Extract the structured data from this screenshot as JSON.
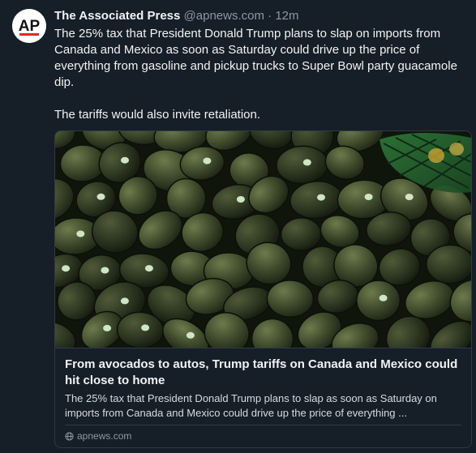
{
  "author": {
    "avatar_text": "AP",
    "display_name": "The Associated Press",
    "handle": "@apnews.com",
    "separator": "·",
    "timestamp": "12m"
  },
  "post": {
    "paragraphs": [
      "The 25% tax that President Donald Trump plans to slap on imports from Canada and Mexico as soon as Saturday could drive up the price of everything from gasoline and pickup trucks to Super Bowl party guacamole dip.",
      "The tariffs would also invite retaliation."
    ]
  },
  "link_card": {
    "title": "From avocados to autos, Trump tariffs on Canada and Mexico could hit close to home",
    "description": "The 25% tax that President Donald Trump plans to slap as soon as Saturday on imports from Canada and Mexico could drive up the price of everything ...",
    "domain": "apnews.com",
    "domain_icon": "globe-icon",
    "image_subject": "avocados"
  },
  "colors": {
    "background": "#161e27",
    "text_primary": "#f1f3f5",
    "text_secondary": "#8b98a5",
    "border": "#2f3b48",
    "avocado": "#3d4a2c"
  }
}
